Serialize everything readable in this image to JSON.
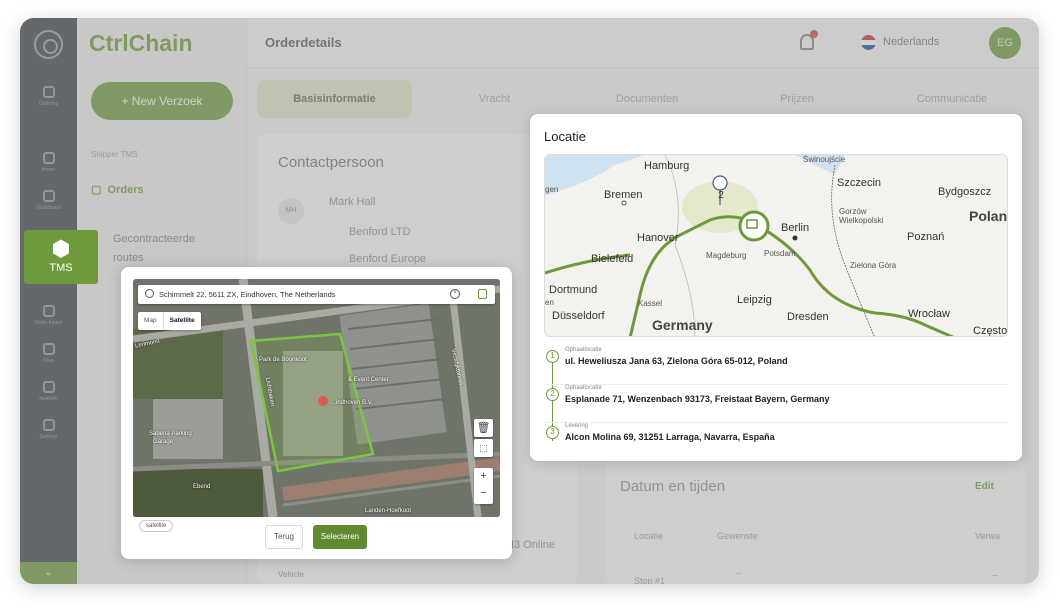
{
  "app": {
    "brand": "CtrlChain",
    "page_title": "Orderdetails",
    "language": "Nederlands",
    "avatar_initials": "EG",
    "new_button": "+ New Verzoek",
    "accent_color": "#6f9a3c"
  },
  "rail": {
    "items": [
      {
        "icon": "clipboard-icon",
        "label": "Ordering"
      },
      {
        "icon": "home-icon",
        "label": "Home"
      },
      {
        "icon": "dashboard-icon",
        "label": "Dashboard"
      },
      {
        "icon": "orders-icon",
        "label": "Order Intake"
      },
      {
        "icon": "files-icon",
        "label": "Files"
      },
      {
        "icon": "network-icon",
        "label": "Netwerk"
      },
      {
        "icon": "settings-icon",
        "label": "Settings"
      }
    ],
    "active": "TMS"
  },
  "sidebar": {
    "section": "Shipper TMS",
    "items": [
      "Orders",
      "Gecontracteerde routes",
      "",
      ""
    ]
  },
  "tabs": [
    "Basisinformatie",
    "Vracht",
    "Documenten",
    "Prijzen",
    "Communicatie"
  ],
  "contact": {
    "heading": "Contactpersoon",
    "initials": "MH",
    "name": "Mark Hall",
    "company1": "Benford LTD",
    "company2": "Benford Europe"
  },
  "dates": {
    "title": "Datum en tijden",
    "edit": "Edit",
    "columns": [
      "Locatie",
      "Gewenste",
      "Verwa"
    ],
    "row1": "Stop #1",
    "dash": "--"
  },
  "background_fragments": {
    "online": "I3 Online",
    "vehicle": "Vehicle"
  },
  "location_popup": {
    "title": "Locatie",
    "map_pin_count": "2",
    "cities": {
      "hamburg": "Hamburg",
      "swinoujscie": "Świnoujście",
      "szczecin": "Szczecin",
      "bydgoszcz": "Bydgoszcz",
      "bremen": "Bremen",
      "gorzow": "Gorzów Wielkopolski",
      "polan": "Polan",
      "gen": "gen",
      "hanover": "Hanover",
      "berlin": "Berlin",
      "poznan": "Poznań",
      "bielefeld": "Bielefeld",
      "magdeburg": "Magdeburg",
      "potsdam": "Potsdam",
      "zielona": "Zielona Góra",
      "dortmund": "Dortmund",
      "kassel": "Kassel",
      "leipzig": "Leipzig",
      "wroclaw": "Wrocław",
      "dusseldorf": "Düsseldorf",
      "germany": "Germany",
      "dresden": "Dresden",
      "czesto": "Często",
      "en": "en"
    },
    "stops": [
      {
        "num": "1",
        "type": "Ophaallocatie",
        "address": "ul. Heweliusza Jana 63, Zielona Góra 65-012, Poland"
      },
      {
        "num": "2",
        "type": "Ophaallocatie",
        "address": "Esplanade 71, Wenzenbach 93173, Freistaat Bayern, Germany"
      },
      {
        "num": "3",
        "type": "Levering",
        "address": "Alcon Molina 69, 31251 Larraga, Navarra, España"
      }
    ]
  },
  "satellite_popup": {
    "search_value": "Schimmelt 22, 5611 ZX, Eindhoven, The Netherlands",
    "map_type_map": "Map",
    "map_type_satellite": "Satellite",
    "labels": {
      "boonkoot": "Park de Boonkoot",
      "event": "& Event Center",
      "bv": "...indhoven B.V.",
      "sabena": "Sabena Parking",
      "garage": "Garage",
      "lichtbaken": "Lichtbaken",
      "vestdijk": "Vestdijktunnel",
      "ebend": "Ebend",
      "hoefkoot": "Landen-Hoefkoot",
      "lerlmond": "Lerlmond"
    },
    "chip": "satellite",
    "back_button": "Terug",
    "select_button": "Selecteren"
  }
}
